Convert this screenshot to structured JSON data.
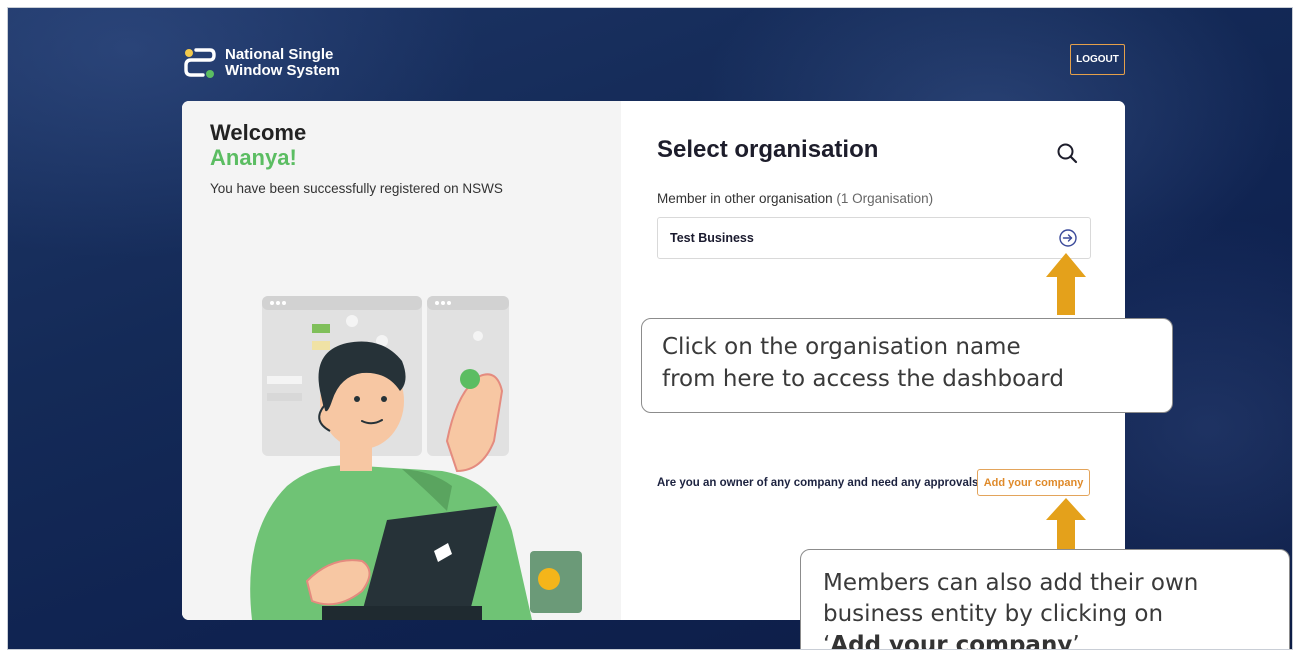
{
  "header": {
    "brand_line1": "National Single",
    "brand_line2": "Window System",
    "logout_label": "LOGOUT"
  },
  "welcome": {
    "title": "Welcome",
    "name": "Ananya!",
    "subtitle": "You have been successfully registered on NSWS"
  },
  "org_panel": {
    "title": "Select organisation",
    "member_label": "Member in other organisation",
    "member_count": "(1 Organisation)",
    "organisations": [
      {
        "name": "Test Business"
      }
    ],
    "owner_question": "Are you an owner of any company and need any approvals?",
    "add_company_label": "Add your company"
  },
  "callouts": {
    "org_line1": "Click on the organisation name",
    "org_line2": "from here to access the dashboard",
    "add_line1": "Members can also add their own",
    "add_line2": "business entity by clicking on",
    "add_quote_open": "‘",
    "add_emphasis": "Add your company",
    "add_quote_close": "’"
  },
  "colors": {
    "accent_green": "#5bbd62",
    "accent_orange": "#e5a04a",
    "callout_arrow": "#e4a11b",
    "background_navy": "#142a57"
  }
}
